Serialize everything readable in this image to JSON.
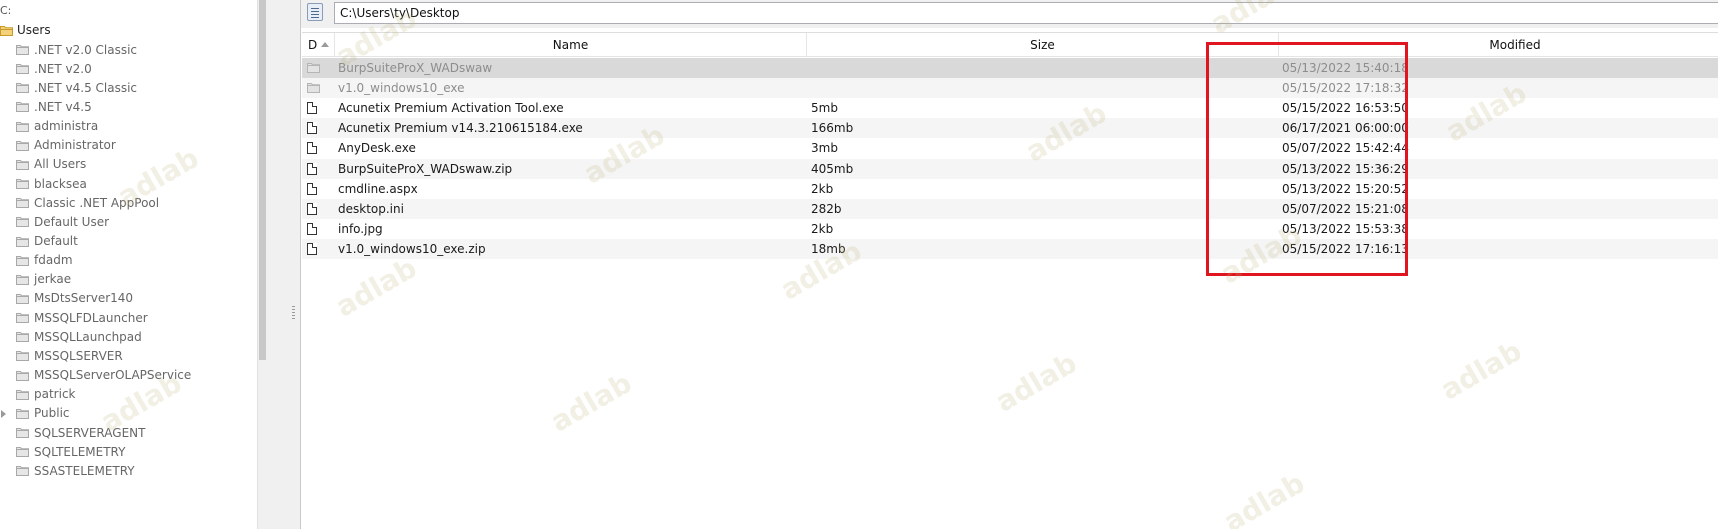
{
  "tree": {
    "root_label": "C:",
    "selected_label": "Users",
    "items": [
      ".NET v2.0 Classic",
      ".NET v2.0",
      ".NET v4.5 Classic",
      ".NET v4.5",
      "administra",
      "Administrator",
      "All Users",
      "blacksea",
      "Classic .NET AppPool",
      "Default User",
      "Default",
      "fdadm",
      "jerkae",
      "MsDtsServer140",
      "MSSQLFDLauncher",
      "MSSQLLaunchpad",
      "MSSQLSERVER",
      "MSSQLServerOLAPService",
      "patrick",
      "Public",
      "SQLSERVERAGENT",
      "SQLTELEMETRY",
      "SSASTELEMETRY"
    ]
  },
  "path_bar": {
    "value": "C:\\Users\\ty\\Desktop"
  },
  "file_list": {
    "headers": {
      "dir": "D",
      "name": "Name",
      "size": "Size",
      "modified": "Modified"
    },
    "rows": [
      {
        "type": "folder",
        "name": "BurpSuiteProX_WADswaw",
        "size": "",
        "modified": "05/13/2022 15:40:18"
      },
      {
        "type": "folder",
        "name": "v1.0_windows10_exe",
        "size": "",
        "modified": "05/15/2022 17:18:32"
      },
      {
        "type": "file",
        "name": "Acunetix Premium Activation Tool.exe",
        "size": "5mb",
        "modified": "05/15/2022 16:53:50"
      },
      {
        "type": "file",
        "name": "Acunetix Premium v14.3.210615184.exe",
        "size": "166mb",
        "modified": "06/17/2021 06:00:00"
      },
      {
        "type": "file",
        "name": "AnyDesk.exe",
        "size": "3mb",
        "modified": "05/07/2022 15:42:44"
      },
      {
        "type": "file",
        "name": "BurpSuiteProX_WADswaw.zip",
        "size": "405mb",
        "modified": "05/13/2022 15:36:29"
      },
      {
        "type": "file",
        "name": "cmdline.aspx",
        "size": "2kb",
        "modified": "05/13/2022 15:20:52"
      },
      {
        "type": "file",
        "name": "desktop.ini",
        "size": "282b",
        "modified": "05/07/2022 15:21:08"
      },
      {
        "type": "file",
        "name": "info.jpg",
        "size": "2kb",
        "modified": "05/13/2022 15:53:38"
      },
      {
        "type": "file",
        "name": "v1.0_windows10_exe.zip",
        "size": "18mb",
        "modified": "05/15/2022 17:16:13"
      }
    ]
  },
  "watermark_text": "adlab",
  "colors": {
    "highlight_box": "#e0151f",
    "selected_row": "#d9d9d9",
    "folder_icon": "#b5b5b5",
    "selected_folder_icon": "#e8b93d"
  }
}
